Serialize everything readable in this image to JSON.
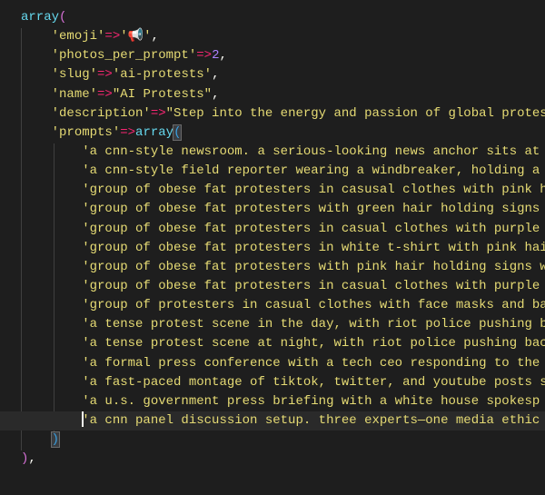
{
  "editor": {
    "colors": {
      "background": "#1e1e1e",
      "string": "#e6db74",
      "keyword": "#66d9ef",
      "operator": "#f92672",
      "number": "#ae81ff",
      "current_line": "#2a2a2a"
    },
    "outer_keyword": "array",
    "open_paren": "(",
    "entries": [
      {
        "key": "'emoji'",
        "op": "=>",
        "value": "'📢'",
        "value_type": "string",
        "suffix": ","
      },
      {
        "key": "'photos_per_prompt'",
        "op": "=>",
        "value": "2",
        "value_type": "number",
        "suffix": ","
      },
      {
        "key": "'slug'",
        "op": "=>",
        "value": "'ai-protests'",
        "value_type": "string",
        "suffix": ","
      },
      {
        "key": "'name'",
        "op": "=>",
        "value": "\"AI Protests\"",
        "value_type": "string",
        "suffix": ","
      },
      {
        "key": "'description'",
        "op": "=>",
        "value": "\"Step into the energy and passion of global protests",
        "value_type": "string",
        "suffix": ""
      }
    ],
    "prompts_key": "'prompts'",
    "prompts_op": "=>",
    "prompts_keyword": "array",
    "prompts": [
      "'a cnn-style newsroom. a serious-looking news anchor sits at",
      "'a cnn-style field reporter wearing a windbreaker, holding a",
      "'group of obese fat protesters in casusal clothes with pink h",
      "'group of obese fat protesters with green hair holding signs",
      "'group of obese fat protesters in casual clothes with purple",
      "'group of obese fat protesters in white t-shirt with pink hai",
      "'group of obese fat protesters with pink hair holding signs w",
      "'group of obese fat protesters in casual clothes with purple",
      "'group of protesters in casual clothes with face masks and ba",
      "'a tense protest scene in the day, with riot police pushing b",
      "'a tense protest scene at night, with riot police pushing bac",
      "'a formal press conference with a tech ceo responding to the",
      "'a fast-paced montage of tiktok, twitter, and youtube posts s",
      "'a u.s. government press briefing with a white house spokesp",
      "'a cnn panel discussion setup. three experts—one media ethic"
    ],
    "inner_close": ")",
    "outer_close": ")",
    "outer_suffix": ","
  }
}
